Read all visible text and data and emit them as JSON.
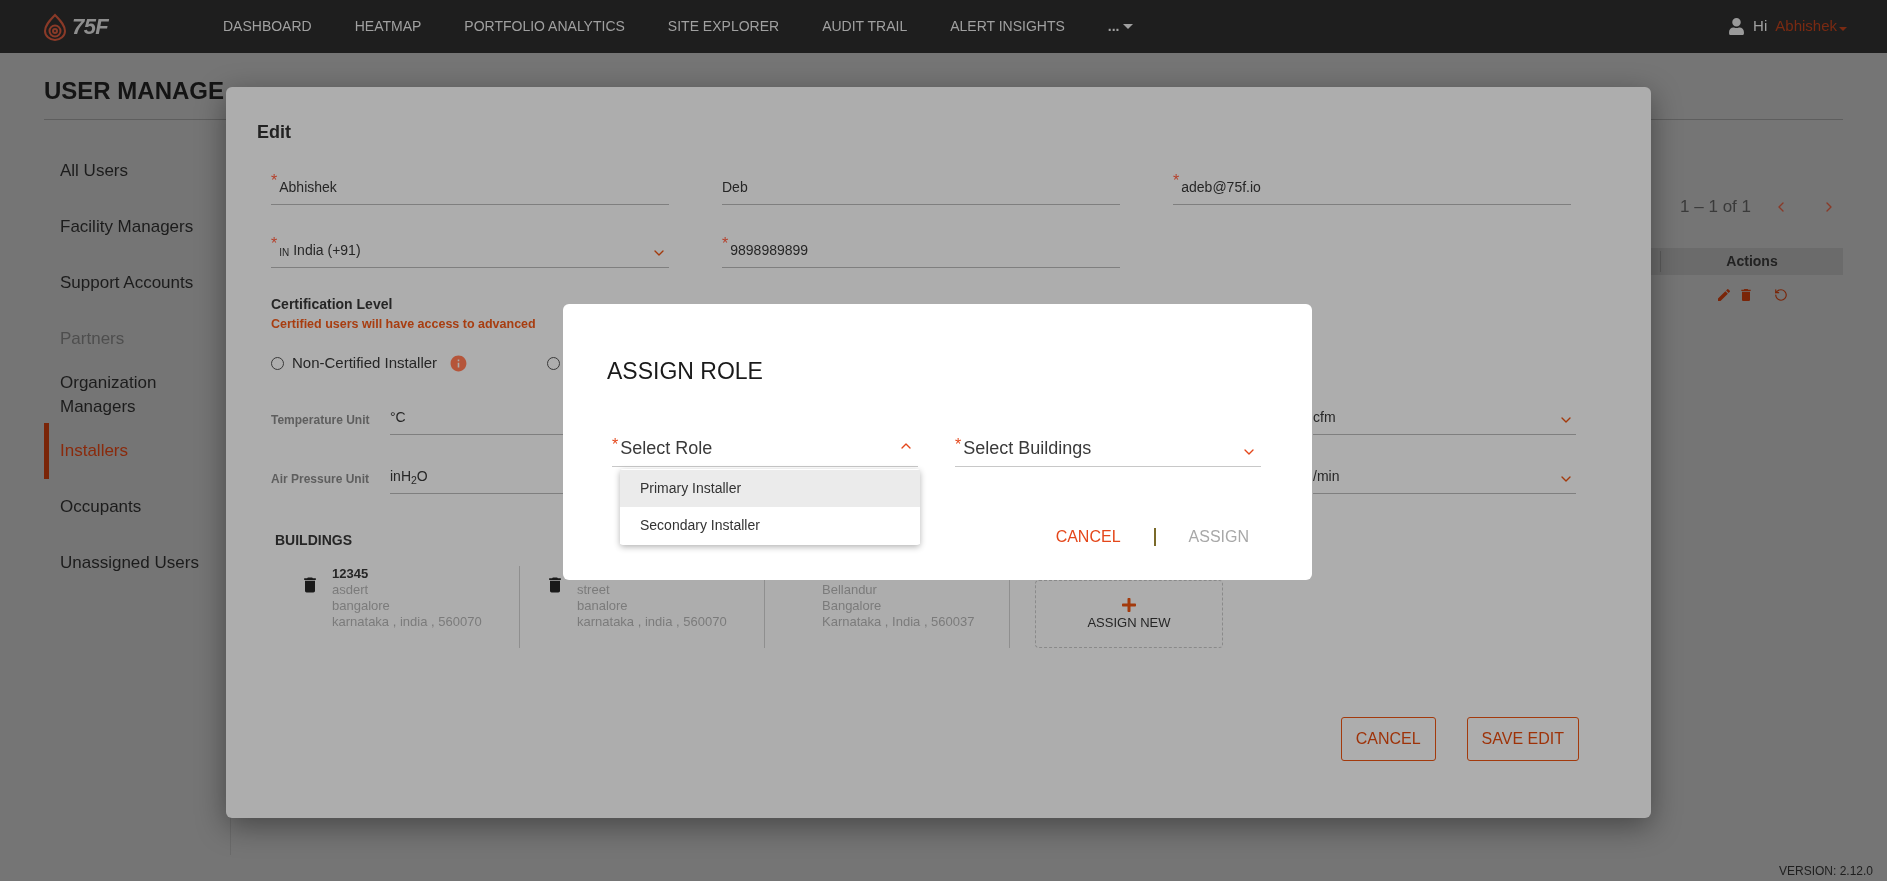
{
  "header": {
    "logo": "75F",
    "nav": [
      {
        "label": "DASHBOARD",
        "kind": "link"
      },
      {
        "label": "HEATMAP",
        "kind": "link"
      },
      {
        "label": "PORTFOLIO ANALYTICS",
        "kind": "link"
      },
      {
        "label": "SITE EXPLORER",
        "kind": "link"
      },
      {
        "label": "AUDIT TRAIL",
        "kind": "link"
      },
      {
        "label": "ALERT INSIGHTS",
        "kind": "link"
      },
      {
        "label": "...",
        "kind": "more"
      }
    ],
    "greeting": "Hi",
    "user": "Abhishek"
  },
  "page": {
    "title": "USER MANAGE",
    "sidebar": [
      {
        "label": "All Users",
        "kind": "link",
        "selected": false
      },
      {
        "label": "Facility Managers",
        "kind": "link",
        "selected": false
      },
      {
        "label": "Support Accounts",
        "kind": "link",
        "selected": false
      },
      {
        "label": "Partners",
        "kind": "heading",
        "selected": false
      },
      {
        "label": "Organization Managers",
        "kind": "link",
        "selected": false
      },
      {
        "label": "Installers",
        "kind": "link",
        "selected": true
      },
      {
        "label": "Occupants",
        "kind": "link",
        "selected": false
      },
      {
        "label": "Unassigned Users",
        "kind": "link",
        "selected": false
      }
    ],
    "pagination": "1 – 1 of 1",
    "table": {
      "columns": [
        "Actions"
      ]
    },
    "version": "VERSION: 2.12.0"
  },
  "edit_dialog": {
    "title": "Edit",
    "name_fields": [
      {
        "value": "Abhishek",
        "marker": "*"
      },
      {
        "value": "Deb"
      },
      {
        "value": "adeb@75f.io",
        "marker": "*"
      }
    ],
    "country": {
      "code": "IN",
      "value": "India (+91)",
      "marker": "*"
    },
    "phone": {
      "value": "9898989899",
      "marker": "*"
    },
    "certification": {
      "title": "Certification Level",
      "note": "Certified users will have access to advanced",
      "options": [
        {
          "label": "Non-Certified Installer",
          "selected": false,
          "info": true
        },
        {
          "selected": false,
          "info": false
        }
      ]
    },
    "units": [
      {
        "label": "Temperature Unit",
        "value": "°C",
        "right_value": "cfm"
      },
      {
        "label": "Air Pressure Unit",
        "value": "inH$_{2}$O",
        "right_value": "/min"
      }
    ],
    "buildings": {
      "title": "BUILDINGS",
      "cards": [
        {
          "name": "12345",
          "delete_icon": true,
          "lines": [
            "asdert",
            "bangalore",
            "karnataka , india , 560070"
          ]
        },
        {
          "delete_icon": true,
          "lines": [
            "street",
            "banalore",
            "karnataka , india , 560070"
          ]
        },
        {
          "delete_icon": false,
          "lines": [
            "Bellandur",
            "Bangalore",
            "Karnataka , India , 560037"
          ]
        }
      ],
      "assign_new": "ASSIGN NEW"
    },
    "buttons": [
      "CANCEL",
      "SAVE EDIT"
    ]
  },
  "assign_role_dialog": {
    "title": "ASSIGN ROLE",
    "fields": [
      {
        "placeholder": "Select Role",
        "marker": "*",
        "expanded": true
      },
      {
        "placeholder": "Select Buildings",
        "marker": "*",
        "expanded": false
      }
    ],
    "menu": [
      {
        "label": "Primary Installer",
        "selected": true
      },
      {
        "label": "Secondary Installer",
        "selected": false
      }
    ],
    "actions": [
      {
        "label": "CANCEL",
        "disabled": false
      },
      {
        "label": "ASSIGN",
        "disabled": true
      }
    ]
  }
}
